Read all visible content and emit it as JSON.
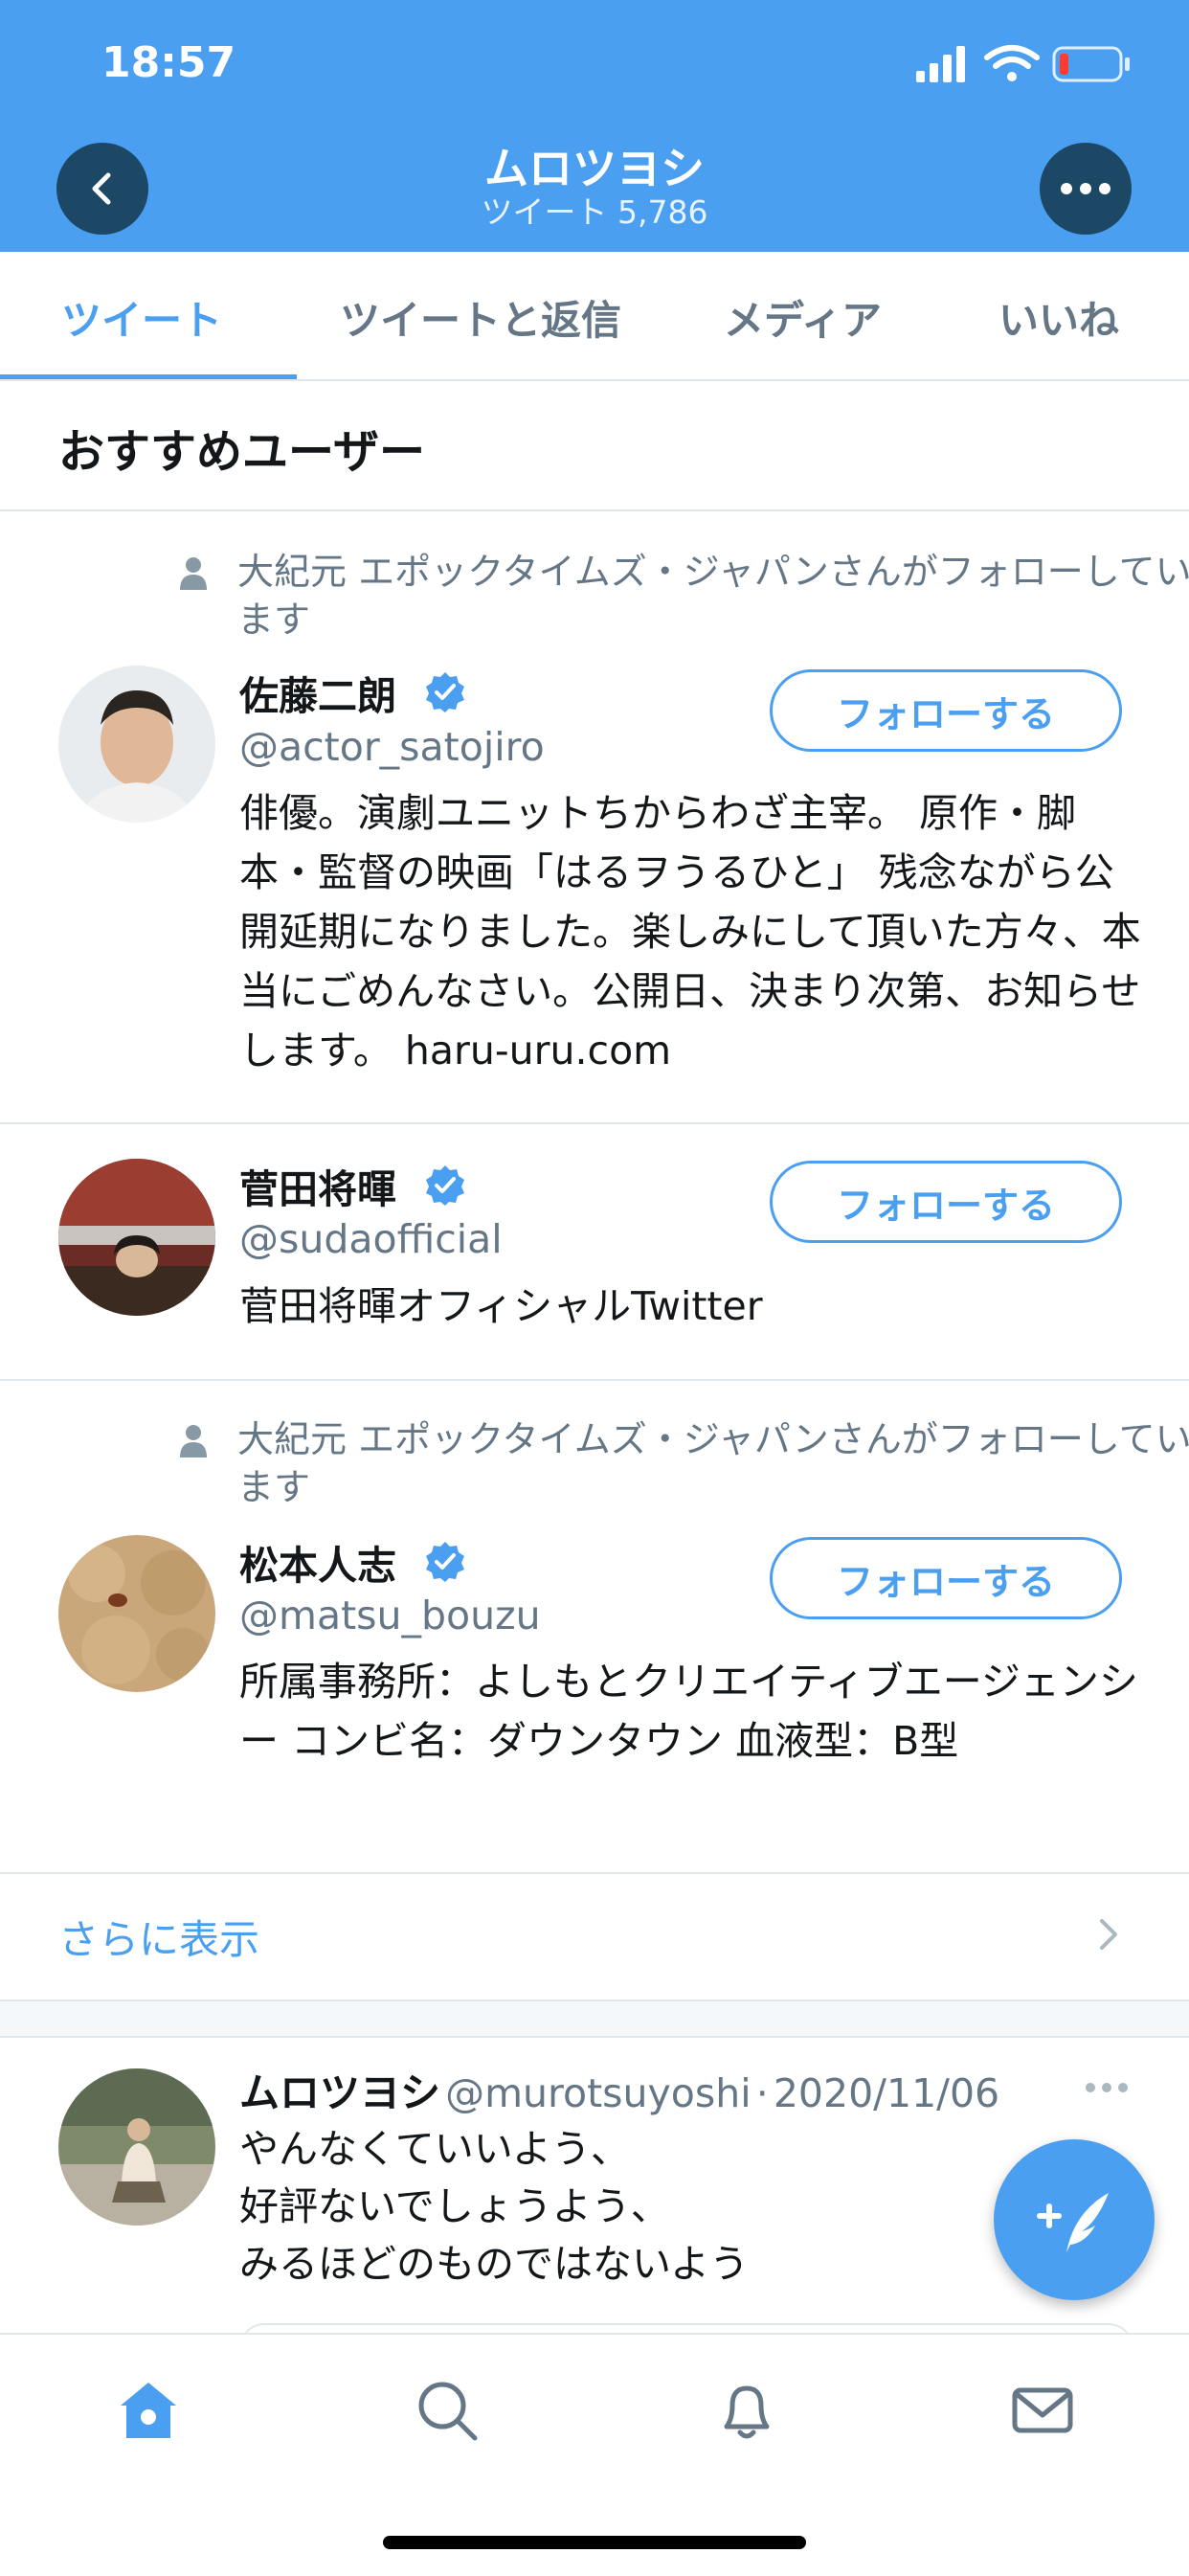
{
  "status_bar": {
    "time": "18:57"
  },
  "header": {
    "title": "ムロツヨシ",
    "subtitle": "ツイート 5,786"
  },
  "tabs": [
    {
      "label": "ツイート",
      "active": true
    },
    {
      "label": "ツイートと返信",
      "active": false
    },
    {
      "label": "メディア",
      "active": false
    },
    {
      "label": "いいね",
      "active": false
    }
  ],
  "recommended": {
    "title": "おすすめユーザー",
    "users": [
      {
        "social_context": "大紀元 エポックタイムズ・ジャパンさんがフォローしています",
        "name": "佐藤二朗",
        "handle": "@actor_satojiro",
        "bio": "俳優。演劇ユニットちからわざ主宰。 原作・脚本・監督の映画「はるヲうるひと」 残念ながら公開延期になりました。楽しみにして頂いた方々、本当にごめんなさい。公開日、決まり次第、お知らせします。 haru-uru.com",
        "follow_label": "フォローする"
      },
      {
        "social_context": "",
        "name": "菅田将暉",
        "handle": "@sudaofficial",
        "bio": "菅田将暉オフィシャルTwitter",
        "follow_label": "フォローする"
      },
      {
        "social_context": "大紀元 エポックタイムズ・ジャパンさんがフォローしています",
        "name": "松本人志",
        "handle": "@matsu_bouzu",
        "bio": "所属事務所：よしもとクリエイティブエージェンシー コンビ名：ダウンタウン 血液型：B型",
        "follow_label": "フォローする"
      }
    ],
    "show_more": "さらに表示"
  },
  "tweet": {
    "name": "ムロツヨシ",
    "handle": "@murotsuyoshi",
    "date": "2020/11/06",
    "lines": [
      "やんなくていいよう、",
      "好評ないでしょうよう、",
      "みるほどのものではないよう"
    ]
  },
  "colors": {
    "accent": "#4a9ff0",
    "header_button": "#1c4866",
    "secondary_text": "#657786"
  },
  "icons": {
    "nav": [
      "home-icon",
      "search-icon",
      "notifications-icon",
      "messages-icon"
    ],
    "fab": "compose-tweet-icon"
  }
}
